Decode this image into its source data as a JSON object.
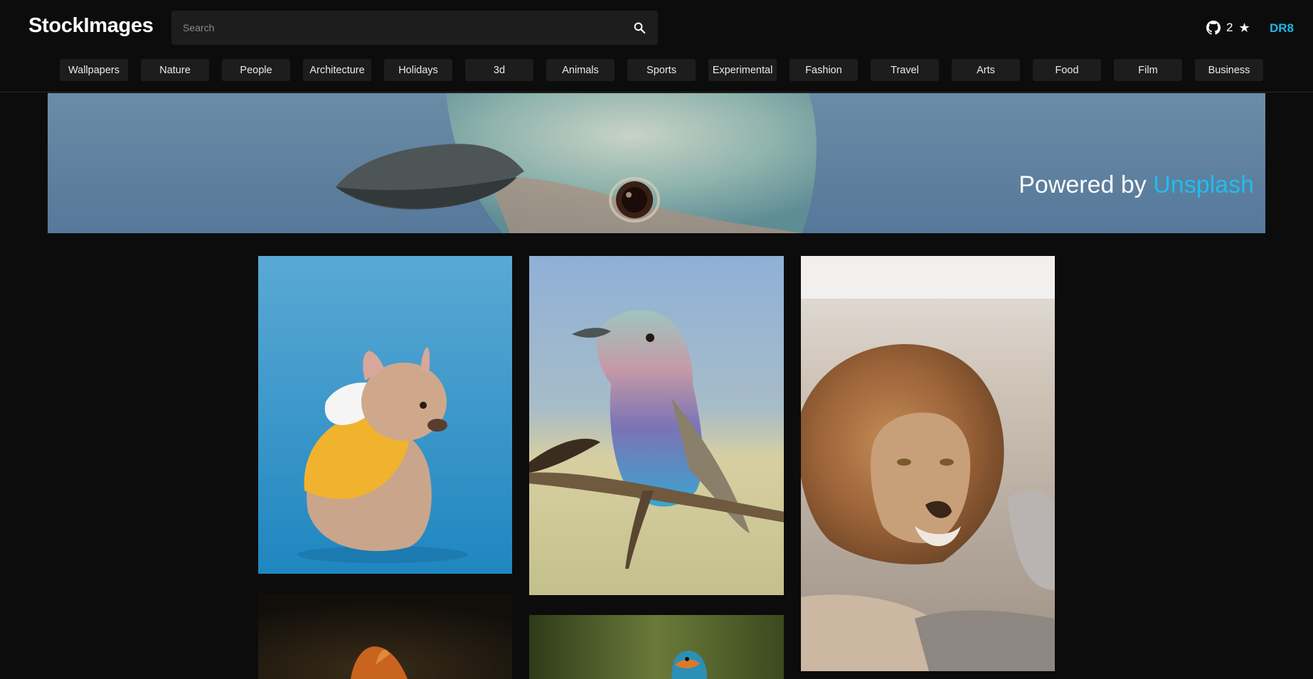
{
  "header": {
    "brand": "StockImages",
    "search": {
      "placeholder": "Search",
      "value": ""
    },
    "github": {
      "count": "2",
      "star": "★",
      "icon": "github-icon"
    },
    "user": "DR8"
  },
  "categories": [
    "Wallpapers",
    "Nature",
    "People",
    "Architecture",
    "Holidays",
    "3d",
    "Animals",
    "Sports",
    "Experimental",
    "Fashion",
    "Travel",
    "Arts",
    "Food",
    "Film",
    "Business"
  ],
  "banner": {
    "powered_by": "Powered by",
    "link": "Unsplash"
  },
  "gallery": [
    {
      "subject": "french bulldog in yellow hoodie",
      "bg": "#3c9dcf"
    },
    {
      "subject": "lilac-breasted roller on branch",
      "bg": "#8fb4d0"
    },
    {
      "subject": "lion resting on rock",
      "bg": "#d6cfc6"
    },
    {
      "subject": "squirrel",
      "bg": "#1a1712"
    },
    {
      "subject": "kingfisher",
      "bg": "#4a5a2a"
    }
  ],
  "colors": {
    "background": "#0c0c0c",
    "chip": "#1d1d1d",
    "accent": "#1fb6ea"
  }
}
